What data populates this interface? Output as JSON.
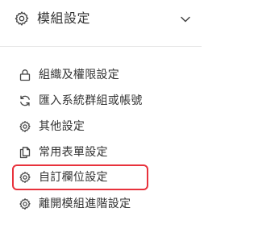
{
  "header": {
    "title": "模組設定",
    "icon": "gear-icon",
    "toggle_icon": "chevron-down-icon"
  },
  "menu": {
    "items": [
      {
        "label": "組織及權限設定",
        "icon": "lock-icon"
      },
      {
        "label": "匯入系統群組或帳號",
        "icon": "sync-icon"
      },
      {
        "label": "其他設定",
        "icon": "gear-icon"
      },
      {
        "label": "常用表單設定",
        "icon": "copy-icon"
      },
      {
        "label": "自訂欄位設定",
        "icon": "gear-icon",
        "highlighted": true
      },
      {
        "label": "離開模組進階設定",
        "icon": "gear-icon"
      }
    ]
  },
  "colors": {
    "text": "#333333",
    "highlight_border": "#e8323c",
    "divider": "#e4e4e4"
  }
}
